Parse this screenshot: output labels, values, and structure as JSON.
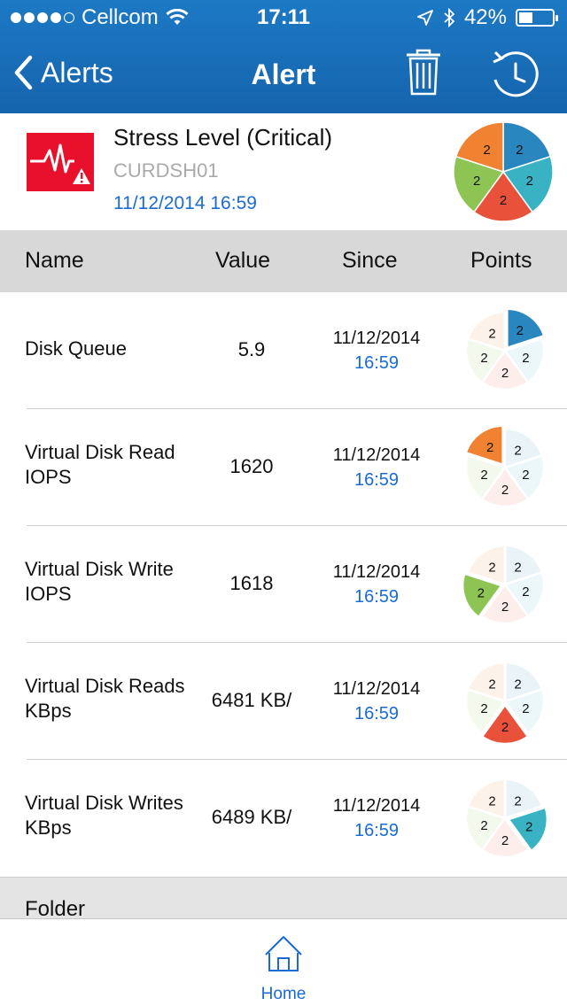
{
  "status_bar": {
    "carrier": "Cellcom",
    "time": "17:11",
    "battery": "42%",
    "battery_level": 0.42,
    "signal_bars": 4
  },
  "nav": {
    "back_label": "Alerts",
    "title": "Alert",
    "icons": [
      "chevron-left-icon",
      "trash-icon",
      "history-icon"
    ]
  },
  "alert": {
    "title": "Stress Level (Critical)",
    "host": "CURDSH01",
    "timestamp": "11/12/2014 16:59",
    "icon": "stress-alert-icon",
    "pie_labels": [
      "2",
      "2",
      "2",
      "2",
      "2"
    ]
  },
  "colors": {
    "accent": "#1a6bd6",
    "nav_bg": "#1768b0",
    "blue": "#2a86bf",
    "teal": "#39b2c4",
    "red": "#e8513a",
    "green": "#8dc453",
    "orange": "#f08232",
    "critical": "#e8102a"
  },
  "table": {
    "headers": {
      "name": "Name",
      "value": "Value",
      "since": "Since",
      "points": "Points"
    },
    "rows": [
      {
        "name": "Disk Queue",
        "value": "5.9",
        "date": "11/12/2014",
        "time": "16:59",
        "highlight": "blue"
      },
      {
        "name": "Virtual Disk Read IOPS",
        "value": "1620",
        "date": "11/12/2014",
        "time": "16:59",
        "highlight": "orange"
      },
      {
        "name": "Virtual Disk Write IOPS",
        "value": "1618",
        "date": "11/12/2014",
        "time": "16:59",
        "highlight": "green"
      },
      {
        "name": "Virtual Disk Reads KBps",
        "value": "6481 KB/",
        "date": "11/12/2014",
        "time": "16:59",
        "highlight": "red"
      },
      {
        "name": "Virtual Disk Writes KBps",
        "value": "6489 KB/",
        "date": "11/12/2014",
        "time": "16:59",
        "highlight": "teal"
      }
    ]
  },
  "folder": {
    "label": "Folder"
  },
  "tabbar": {
    "home_label": "Home",
    "home_icon": "home-icon"
  }
}
